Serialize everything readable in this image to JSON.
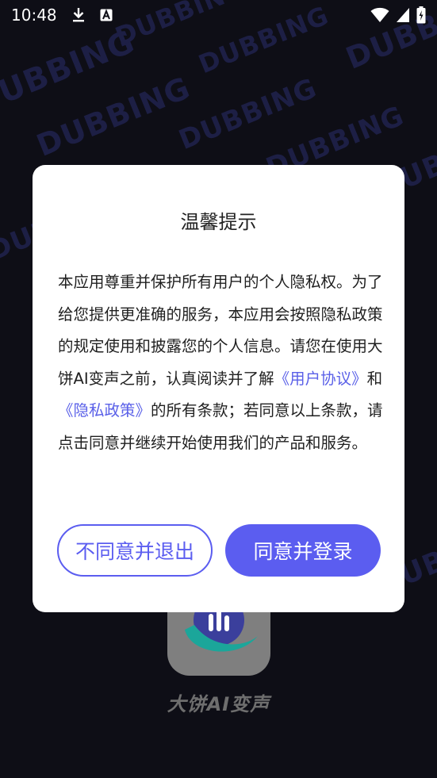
{
  "status_bar": {
    "time": "10:48"
  },
  "watermark": {
    "text": "DUBBING"
  },
  "dialog": {
    "title": "温馨提示",
    "body_part1": "本应用尊重并保护所有用户的个人隐私权。为了给您提供更准确的服务，本应用会按照隐私政策的规定使用和披露您的个人信息。请您在使用大饼AI变声之前，认真阅读并了解",
    "user_agreement_link": "《用户协议》",
    "conjunction": "和",
    "privacy_policy_link": "《隐私政策》",
    "body_part2": "的所有条款；若同意以上条款，请点击同意并继续开始使用我们的产品和服务。",
    "decline_label": "不同意并退出",
    "accept_label": "同意并登录"
  },
  "app": {
    "name": "大饼AI变声"
  },
  "colors": {
    "accent": "#5b5df0",
    "link": "#5a60e8",
    "background": "#0e0e16"
  }
}
